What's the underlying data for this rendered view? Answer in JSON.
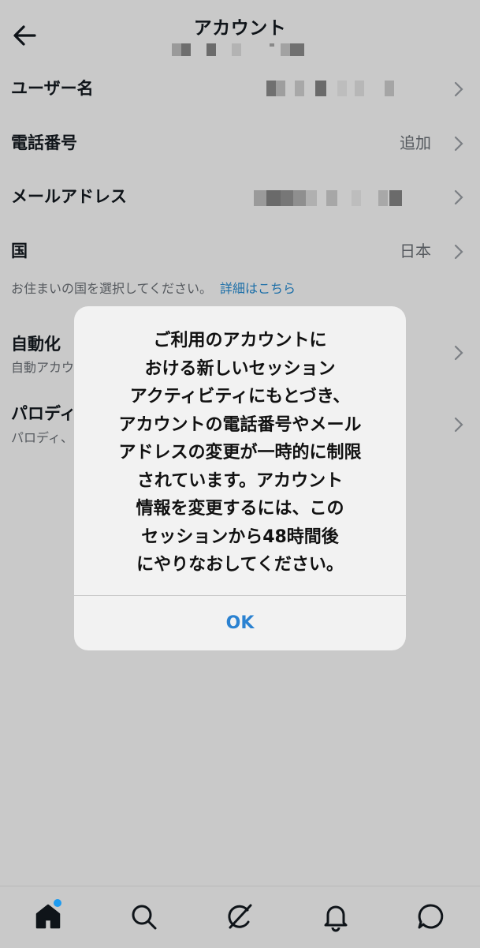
{
  "header": {
    "title": "アカウント",
    "back_icon": "arrow-left-icon"
  },
  "rows": [
    {
      "label": "ユーザー名",
      "value": ""
    },
    {
      "label": "電話番号",
      "value": "追加"
    },
    {
      "label": "メールアドレス",
      "value": ""
    },
    {
      "label": "国",
      "value": "日本"
    }
  ],
  "country_hint": {
    "text": "お住まいの国を選択してください。",
    "link": "詳細はこちら"
  },
  "automation": {
    "label": "自動化",
    "sub": "自動アカウ"
  },
  "parody": {
    "label": "パロディ",
    "sub": "パロディ、"
  },
  "dialog": {
    "lines": [
      "ご利用のアカウントに",
      "おける新しいセッション",
      "アクティビティにもとづき、",
      "アカウントの電話番号やメール",
      "アドレスの変更が一時的に制限",
      "されています。アカウント",
      "情報を変更するには、この",
      "セッションから48時間後",
      "にやりなおしてください。"
    ],
    "ok": "OK"
  },
  "colors": {
    "background": "#c9c9c9",
    "dialog_bg": "#f2f2f2",
    "link": "#1d6fa8",
    "ok": "#2b82d1",
    "notification_dot": "#1d9bf0"
  },
  "tabbar": {
    "items": [
      "home-icon",
      "search-icon",
      "grok-icon",
      "bell-icon",
      "message-icon"
    ]
  }
}
